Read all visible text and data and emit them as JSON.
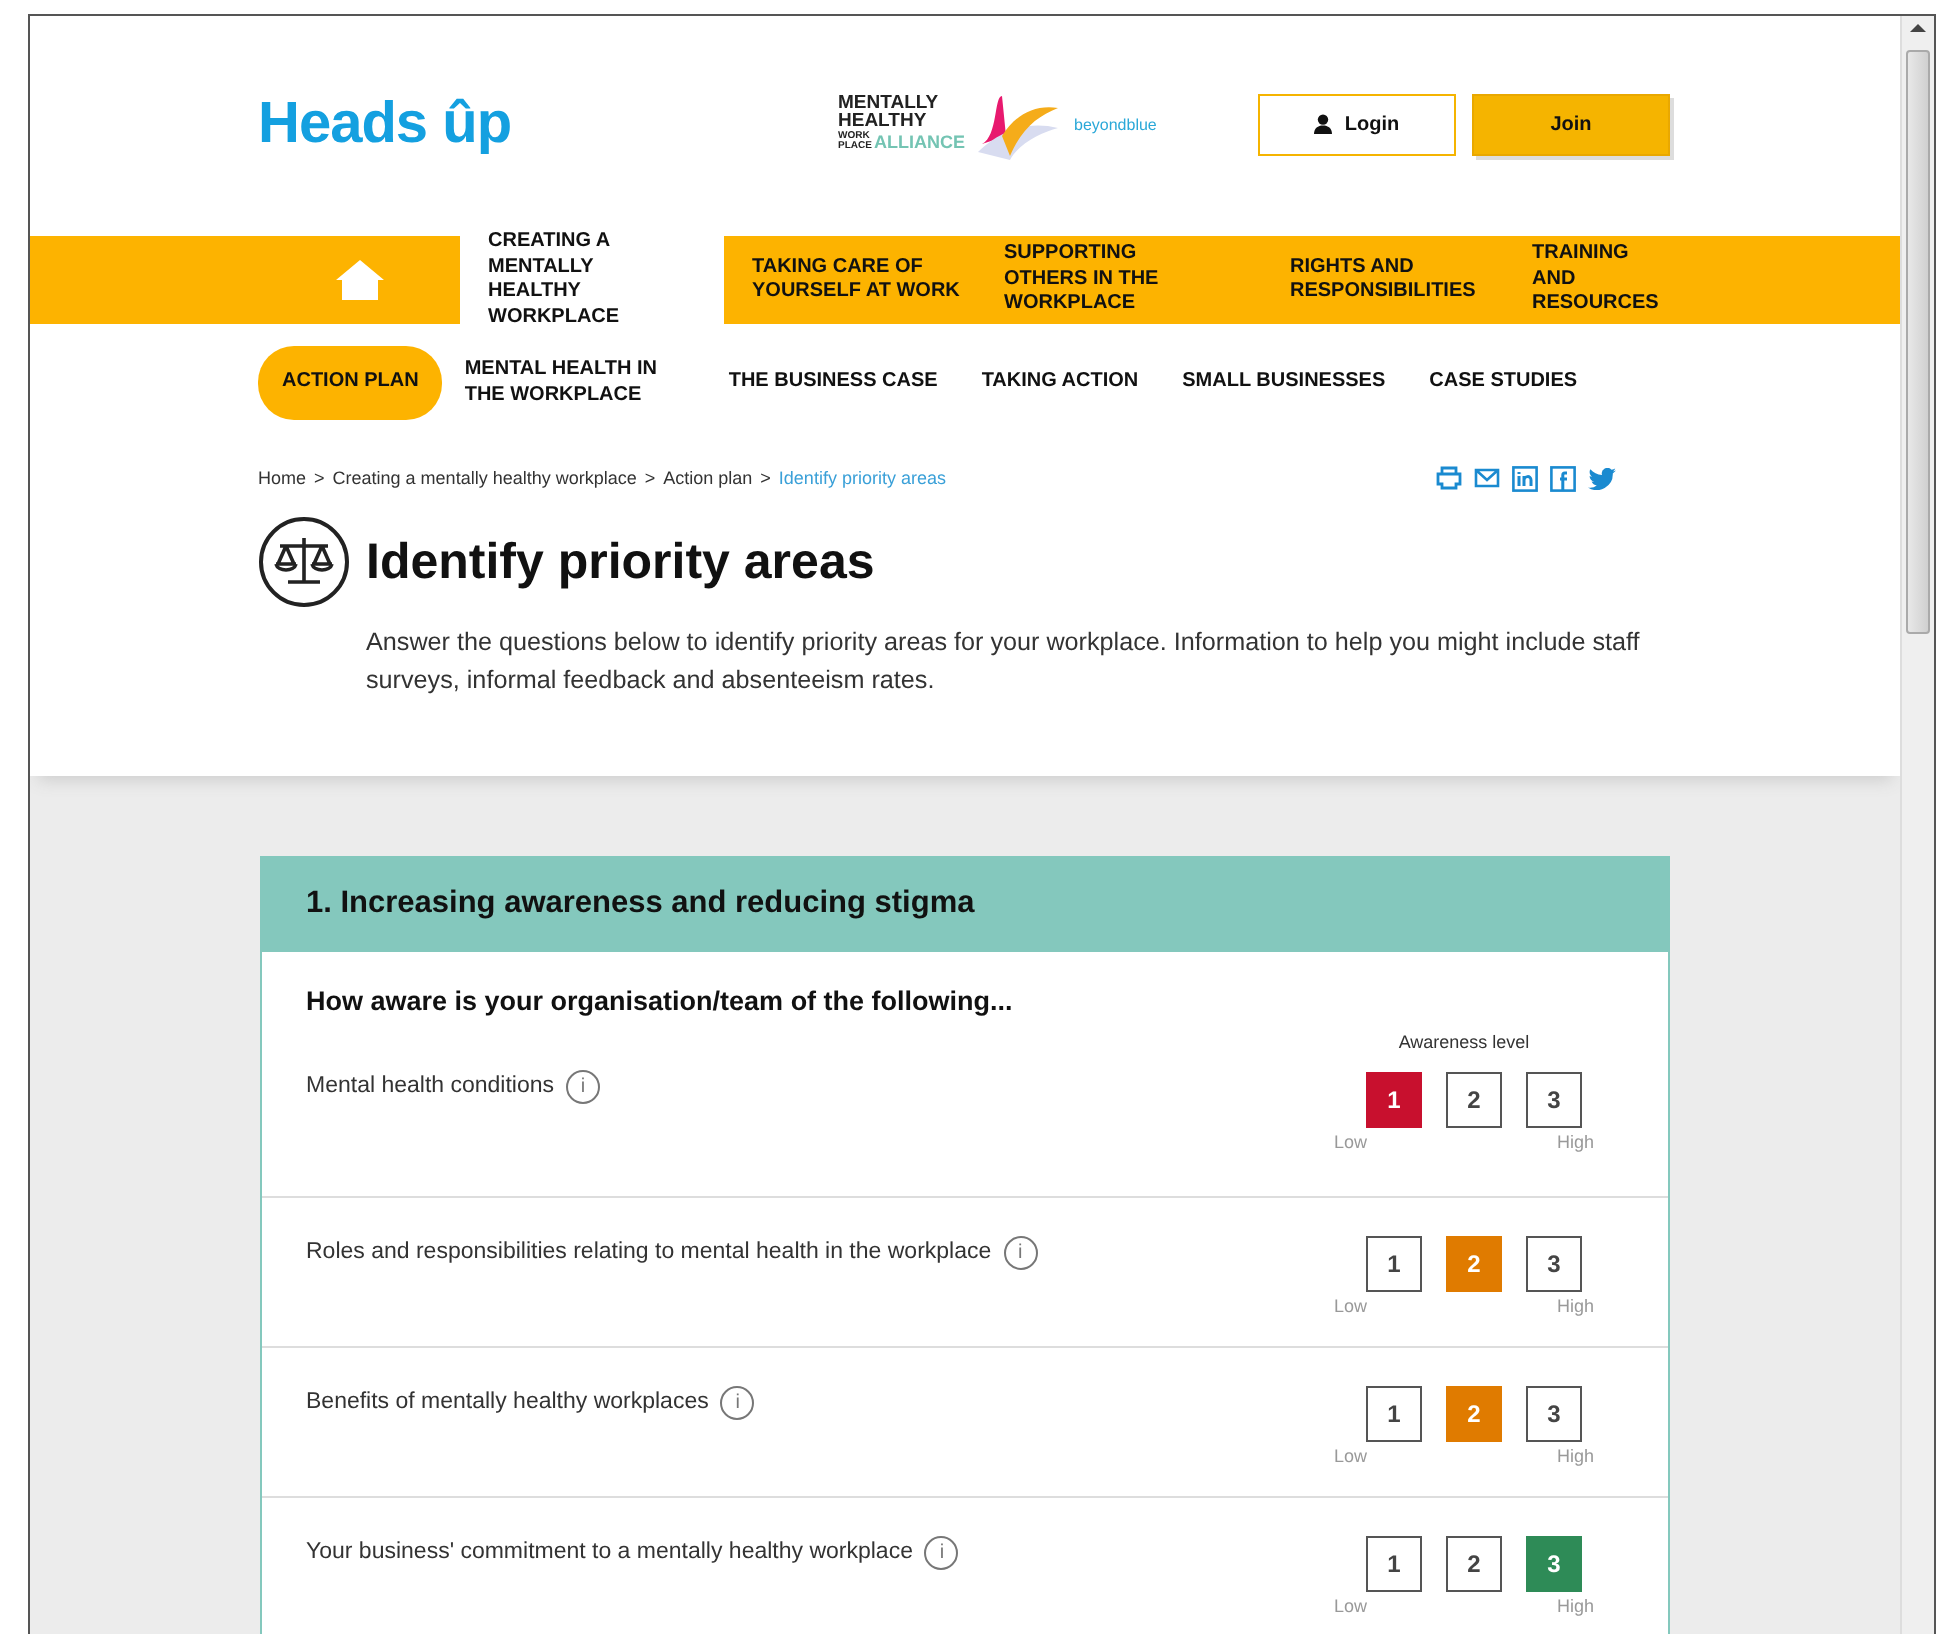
{
  "logo": {
    "text": "Heads ûp"
  },
  "alliance_logo": {
    "lines": [
      "MENTALLY",
      "HEALTHY"
    ],
    "small": [
      "WORK",
      "PLACE"
    ],
    "accent": "ALLIANCE"
  },
  "partner_logo": {
    "text": "beyondblue"
  },
  "account_buttons": [
    {
      "label": "Login",
      "kind": "outline"
    },
    {
      "label": "Join",
      "kind": "filled"
    }
  ],
  "nav": [
    {
      "kind": "home",
      "selected": false
    },
    {
      "kind": "link",
      "label": "CREATING A MENTALLY HEALTHY WORKPLACE",
      "selected": true
    },
    {
      "kind": "link",
      "label": "TAKING CARE OF YOURSELF AT WORK",
      "selected": false
    },
    {
      "kind": "link",
      "label": "SUPPORTING OTHERS IN THE WORKPLACE",
      "selected": false
    },
    {
      "kind": "link",
      "label": "RIGHTS AND RESPONSIBILITIES",
      "selected": false
    },
    {
      "kind": "link",
      "label": "TRAINING AND RESOURCES",
      "selected": false
    }
  ],
  "subnav": [
    {
      "label": "ACTION PLAN",
      "selected": true
    },
    {
      "label": "MENTAL HEALTH IN THE WORKPLACE",
      "selected": false
    },
    {
      "label": "THE BUSINESS CASE",
      "selected": false
    },
    {
      "label": "TAKING ACTION",
      "selected": false
    },
    {
      "label": "SMALL BUSINESSES",
      "selected": false
    },
    {
      "label": "CASE STUDIES",
      "selected": false
    }
  ],
  "breadcrumb": [
    {
      "label": "Home",
      "current": false
    },
    {
      "label": "Creating a mentally healthy workplace",
      "current": false
    },
    {
      "label": "Action plan",
      "current": false
    },
    {
      "label": "Identify priority areas",
      "current": true
    }
  ],
  "breadcrumb_separator": ">",
  "page": {
    "title": "Identify priority areas",
    "intro": "Answer the questions below to identify priority areas for your workplace. Information to help you might include staff surveys, informal feedback and absenteeism rates."
  },
  "sections": [
    {
      "title": "1. Increasing awareness and reducing stigma",
      "question": "How aware is your organisation/team of the following...",
      "scale_title": "Awareness level",
      "rows": [
        {
          "label": "Mental health conditions",
          "info": "i",
          "low": "Low",
          "high": "High",
          "options": [
            {
              "label": "1",
              "selected": true,
              "color": "#c8102e"
            },
            {
              "label": "2",
              "selected": false
            },
            {
              "label": "3",
              "selected": false
            }
          ]
        },
        {
          "label": "Roles and responsibilities relating to mental health in the workplace",
          "info": "i",
          "low": "Low",
          "high": "High",
          "options": [
            {
              "label": "1",
              "selected": false
            },
            {
              "label": "2",
              "selected": true,
              "color": "#e07b00"
            },
            {
              "label": "3",
              "selected": false
            }
          ]
        },
        {
          "label": "Benefits of mentally healthy workplaces",
          "info": "i",
          "low": "Low",
          "high": "High",
          "options": [
            {
              "label": "1",
              "selected": false
            },
            {
              "label": "2",
              "selected": true,
              "color": "#e07b00"
            },
            {
              "label": "3",
              "selected": false
            }
          ]
        },
        {
          "label": "Your business' commitment to a mentally healthy workplace",
          "info": "i",
          "low": "Low",
          "high": "High",
          "options": [
            {
              "label": "1",
              "selected": false
            },
            {
              "label": "2",
              "selected": false
            },
            {
              "label": "3",
              "selected": true,
              "color": "#2e8b57"
            }
          ]
        }
      ]
    }
  ]
}
